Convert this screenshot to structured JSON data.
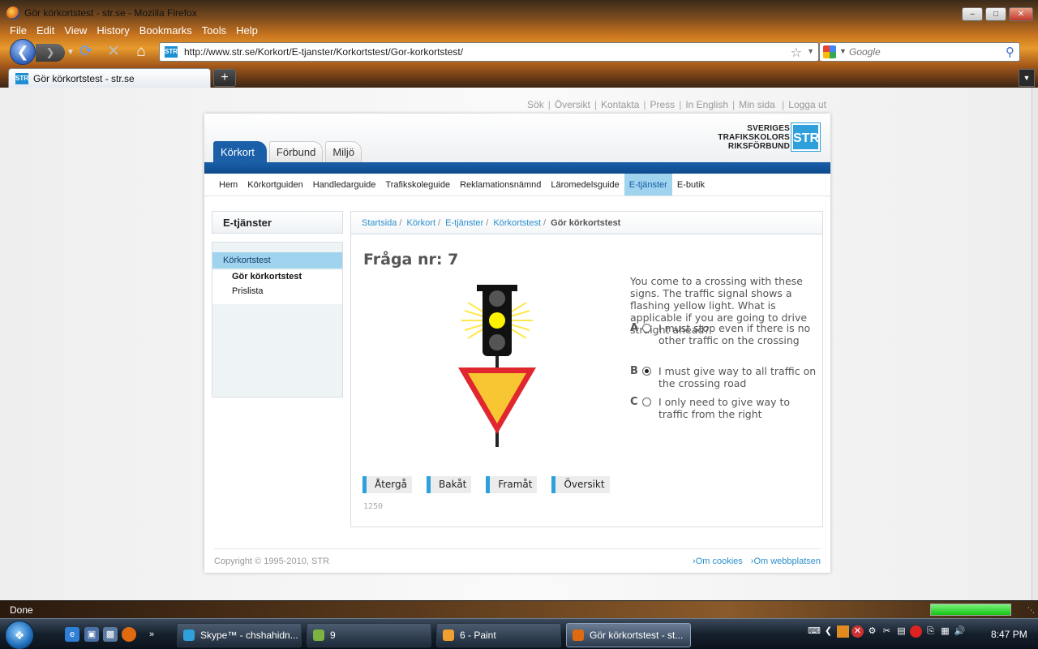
{
  "window": {
    "title": "Gör körkortstest - str.se - Mozilla Firefox",
    "controls": [
      "minimize",
      "maximize",
      "close"
    ]
  },
  "menu": [
    "File",
    "Edit",
    "View",
    "History",
    "Bookmarks",
    "Tools",
    "Help"
  ],
  "nav": {
    "url": "http://www.str.se/Korkort/E-tjanster/Korkortstest/Gor-korkortstest/",
    "search_placeholder": "Google",
    "favicon_text": "STR"
  },
  "tab": {
    "label": "Gör körkortstest - str.se",
    "new_tab": "+"
  },
  "page": {
    "top_links": [
      "Sök",
      "Översikt",
      "Kontakta",
      "Press",
      "In English",
      "Min sida",
      "Logga ut"
    ],
    "logo": {
      "line1": "SVERIGES",
      "line2": "TRAFIKSKOLORS",
      "line3": "RIKSFÖRBUND",
      "mark": "STR"
    },
    "main_tabs": [
      "Körkort",
      "Förbund",
      "Miljö"
    ],
    "sub_nav": [
      "Hem",
      "Körkortguiden",
      "Handledarguide",
      "Trafikskoleguide",
      "Reklamationsnämnd",
      "Läromedelsguide",
      "E-tjänster",
      "E-butik"
    ],
    "sub_nav_active": "E-tjänster",
    "sidebar": {
      "title": "E-tjänster",
      "active": "Körkortstest",
      "current": "Gör körkortstest",
      "other": "Prislista"
    },
    "breadcrumb": [
      "Startsida",
      "Körkort",
      "E-tjänster",
      "Körkortstest"
    ],
    "breadcrumb_current": "Gör körkortstest",
    "question_title": "Fråga nr: 7",
    "question_text": "You come to a crossing with these signs. The traffic signal shows a flashing yellow light. What is applicable if you are going to drive straight ahead?",
    "options": [
      {
        "letter": "A",
        "text": "I must stop even if there is no other traffic on the crossing",
        "selected": false
      },
      {
        "letter": "B",
        "text": "I must give way to all traffic on the crossing road",
        "selected": true
      },
      {
        "letter": "C",
        "text": "I only need to give way to traffic from the right",
        "selected": false
      }
    ],
    "buttons": [
      "Återgå",
      "Bakåt",
      "Framåt",
      "Översikt"
    ],
    "question_code": "1250",
    "footer": {
      "copyright": "Copyright © 1995-2010, STR",
      "links": [
        "Om cookies",
        "Om webbplatsen"
      ]
    }
  },
  "status": {
    "text": "Done",
    "progress": 1.0
  },
  "taskbar": {
    "items": [
      {
        "label": "Skype™ - chshahidn...",
        "active": false,
        "color": "#2fa0dc"
      },
      {
        "label": "9",
        "active": false,
        "color": "#7cb342"
      },
      {
        "label": "6 - Paint",
        "active": false,
        "color": "#f0a030"
      },
      {
        "label": "Gör körkortstest - st...",
        "active": true,
        "color": "#e06a10"
      }
    ],
    "clock": "8:47 PM"
  }
}
